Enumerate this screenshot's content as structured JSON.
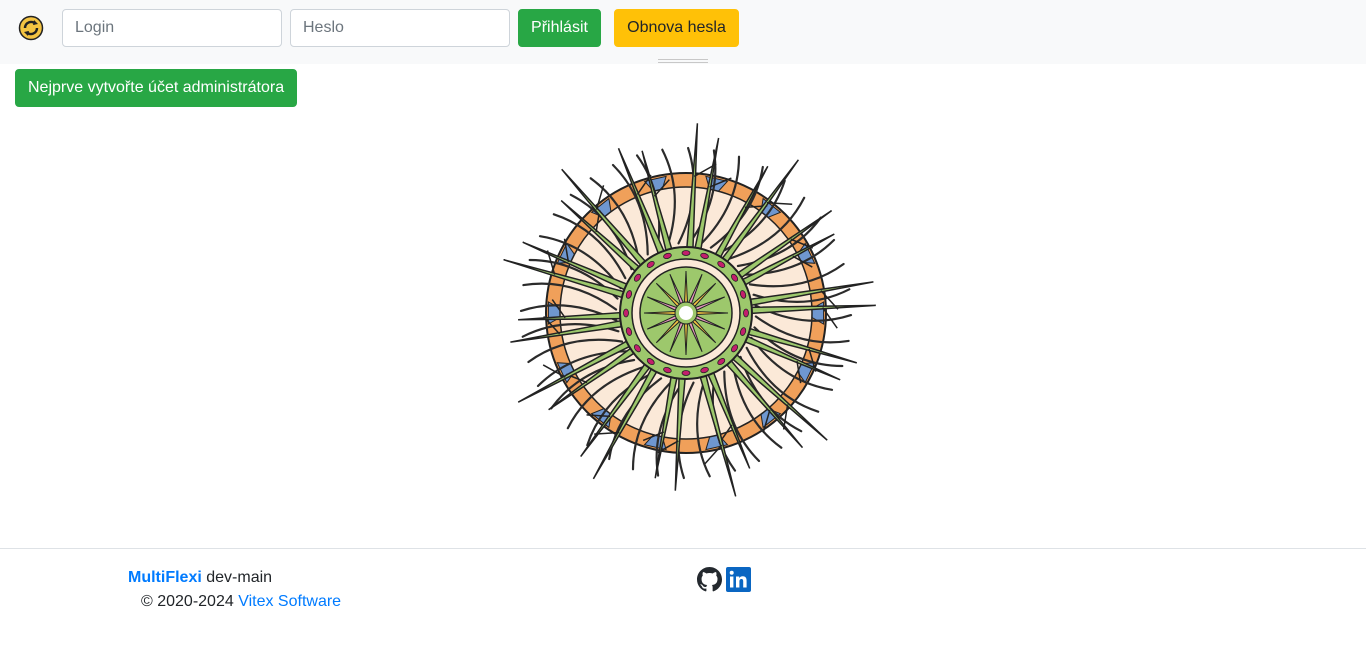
{
  "navbar": {
    "logo_icon": "multiflexi-logo-icon",
    "login_placeholder": "Login",
    "login_value": "",
    "password_placeholder": "Heslo",
    "password_value": "",
    "login_button": "Přihlásit",
    "reset_button": "Obnova hesla"
  },
  "main": {
    "create_admin_button": "Nejprve vytvořte účet administrátora",
    "illustration_icon": "mandala-illustration"
  },
  "footer": {
    "app_name": "MultiFlexi",
    "version": "dev-main",
    "copyright_prefix": "© 2020-2024",
    "company": "Vitex Software",
    "social_icons": [
      "github-icon",
      "linkedin-icon"
    ]
  },
  "colors": {
    "navbar_bg": "#f8f9fa",
    "success": "#28a745",
    "warning": "#ffc107",
    "link": "#007bff",
    "mandala_green": "#9dc86c",
    "mandala_orange": "#f0a05a",
    "mandala_cream": "#fbe9d8",
    "mandala_blue": "#6f97d0",
    "mandala_magenta": "#c21f6c",
    "mandala_pink": "#e89ac0",
    "mandala_yellow": "#f4c442"
  }
}
